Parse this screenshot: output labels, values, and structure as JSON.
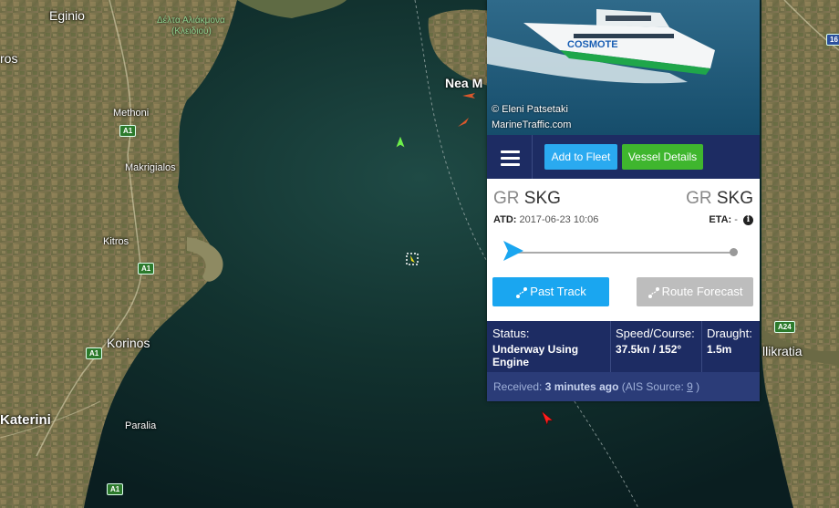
{
  "map": {
    "places": [
      {
        "id": "eginio",
        "text": "Eginio"
      },
      {
        "id": "pros",
        "text": "ros"
      },
      {
        "id": "delta",
        "text": "Δέλτα Αλιάκμονα"
      },
      {
        "id": "kleidiou",
        "text": "(Κλειδιού)"
      },
      {
        "id": "methoni",
        "text": "Methoni"
      },
      {
        "id": "makrigialos",
        "text": "Makrigialos"
      },
      {
        "id": "kitros",
        "text": "Kitros"
      },
      {
        "id": "korinos",
        "text": "Korinos"
      },
      {
        "id": "katerini",
        "text": "Katerini"
      },
      {
        "id": "paralia",
        "text": "Paralia"
      },
      {
        "id": "nea",
        "text": "Nea M"
      },
      {
        "id": "kalikratia",
        "text": "llikratia"
      }
    ],
    "shields": [
      {
        "id": "a1a",
        "text": "A1"
      },
      {
        "id": "a1b",
        "text": "A1"
      },
      {
        "id": "a1c",
        "text": "A1"
      },
      {
        "id": "a1d",
        "text": "A1"
      },
      {
        "id": "a24",
        "text": "A24"
      },
      {
        "id": "e16",
        "text": "16"
      }
    ]
  },
  "popup": {
    "photo": {
      "credit_line1": "© Eleni Patsetaki",
      "credit_line2": "MarineTraffic.com",
      "ship_brand": "COSMOTE"
    },
    "toolbar": {
      "add_fleet": "Add to Fleet",
      "vessel_details": "Vessel Details"
    },
    "origin": {
      "country": "GR",
      "port": "SKG"
    },
    "destination": {
      "country": "GR",
      "port": "SKG"
    },
    "atd": {
      "label": "ATD:",
      "value": "2017-06-23 10:06"
    },
    "eta": {
      "label": "ETA:",
      "value": "-"
    },
    "progress": 0,
    "buttons": {
      "past_track": "Past Track",
      "route_forecast": "Route Forecast"
    },
    "stats": {
      "status_label": "Status:",
      "status_value": "Underway Using Engine",
      "speed_label": "Speed/Course:",
      "speed_value": "37.5kn / 152°",
      "draught_label": "Draught:",
      "draught_value": "1.5m"
    },
    "received": {
      "prefix": "Received:",
      "time": "3 minutes ago",
      "source_prefix": "(AIS Source:",
      "source_id": "9",
      "source_suffix": ")"
    }
  },
  "colors": {
    "toolbar_bg": "#1d2c63",
    "add_fleet": "#2aaaf0",
    "vessel_details": "#3fb62e",
    "past_track": "#1aa6f0",
    "route_forecast": "#bdbdbd"
  },
  "icons": [
    "hamburger-menu-icon",
    "track-icon",
    "info-icon",
    "ship-arrow-icon",
    "vessel-marker-icon"
  ]
}
